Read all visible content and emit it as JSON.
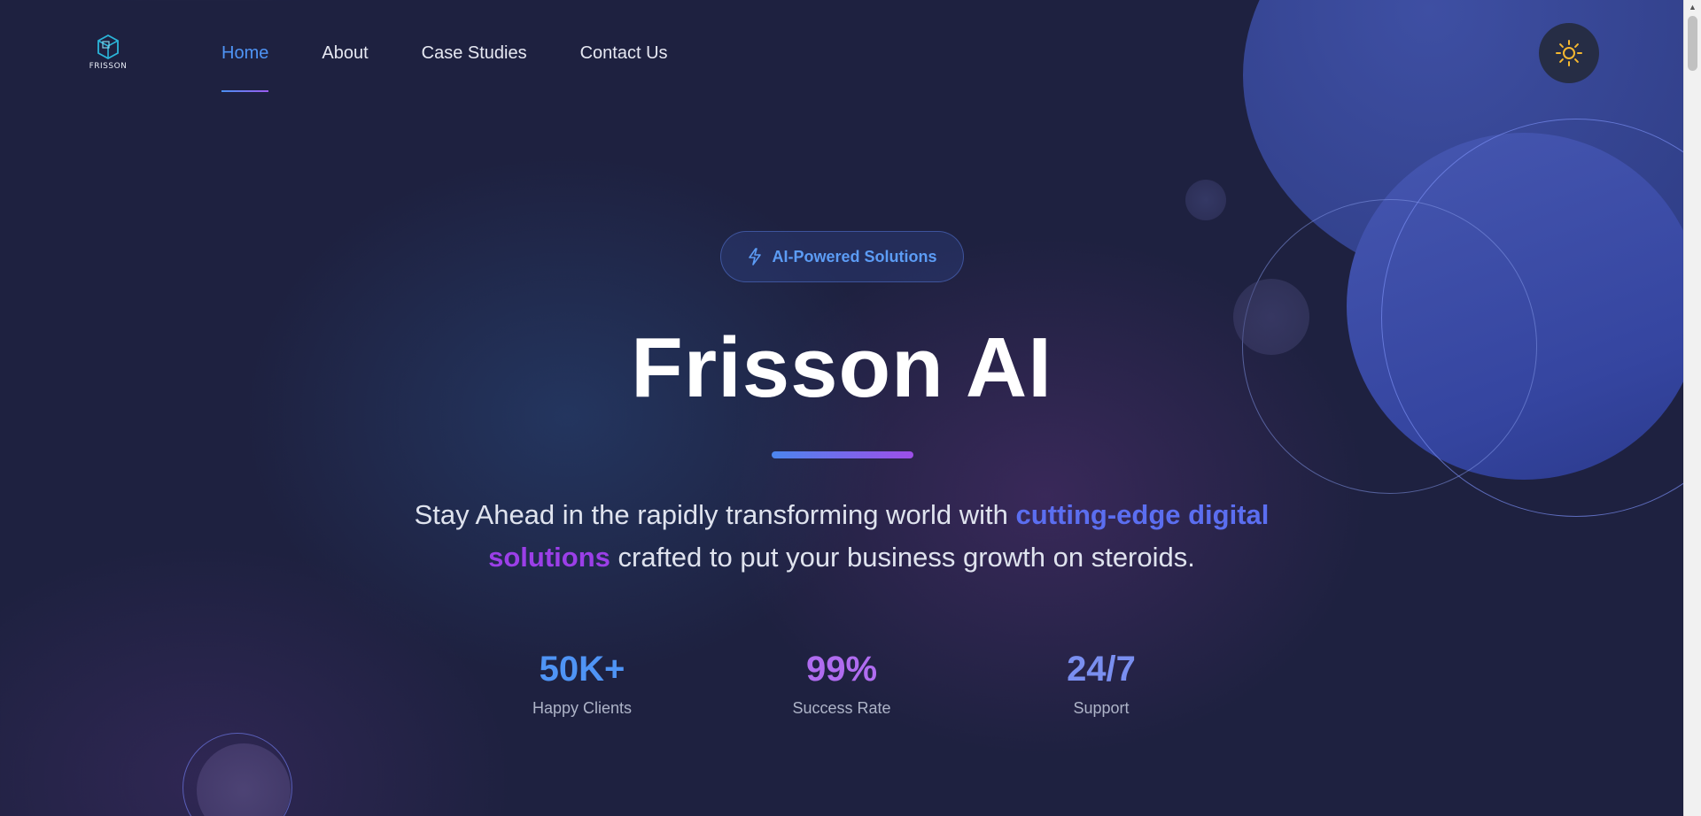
{
  "brand": {
    "name": "FRISSON",
    "logo_icon": "frisson-cube-logo"
  },
  "nav": {
    "items": [
      {
        "label": "Home",
        "active": true
      },
      {
        "label": "About",
        "active": false
      },
      {
        "label": "Case Studies",
        "active": false
      },
      {
        "label": "Contact Us",
        "active": false
      }
    ]
  },
  "theme_toggle": {
    "icon": "sun-icon",
    "color": "#f5b830"
  },
  "hero": {
    "badge": {
      "icon": "lightning-icon",
      "label": "AI-Powered Solutions"
    },
    "title": "Frisson AI",
    "subtitle": {
      "before": "Stay Ahead in the rapidly transforming world with",
      "highlight_1": "cutting-edge digital",
      "highlight_2": "solutions",
      "after": "crafted to put your business growth on steroids."
    }
  },
  "stats": [
    {
      "value": "50K+",
      "label": "Happy Clients"
    },
    {
      "value": "99%",
      "label": "Success Rate"
    },
    {
      "value": "24/7",
      "label": "Support"
    }
  ],
  "colors": {
    "background": "#1e2140",
    "accent_blue": "#4f94f5",
    "accent_purple": "#9b3fe8"
  }
}
